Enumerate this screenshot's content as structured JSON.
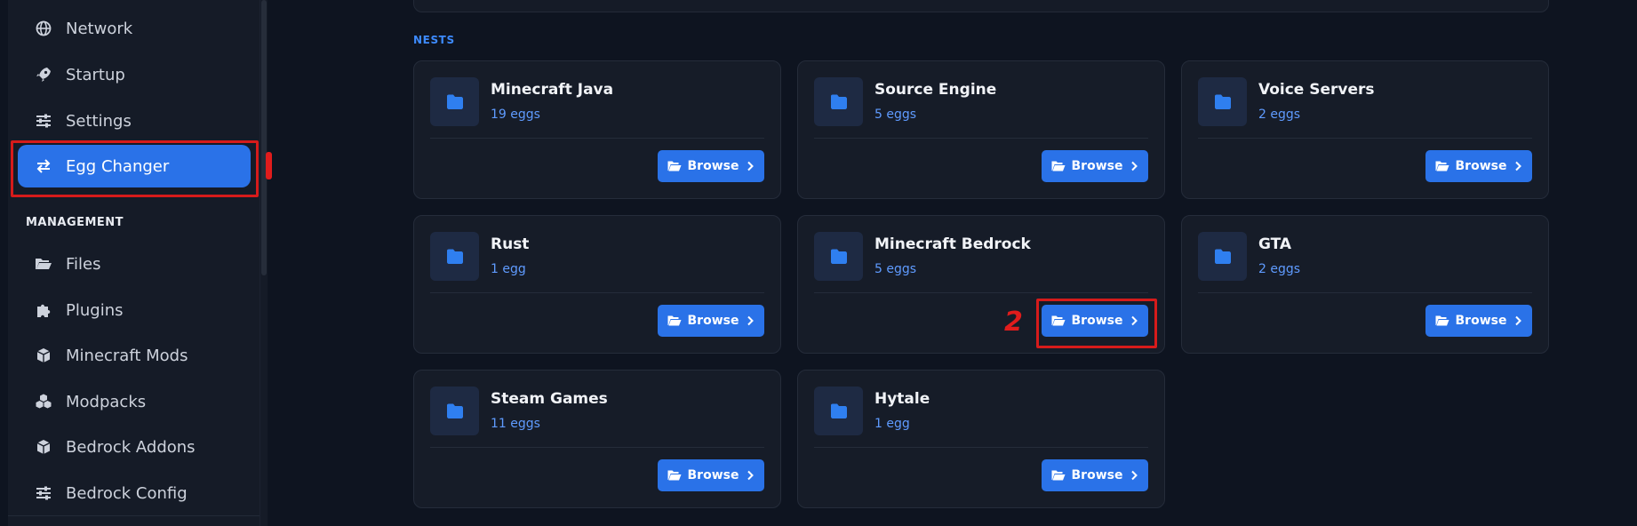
{
  "sidebar": {
    "items": [
      {
        "label": "Network",
        "icon": "globe-icon"
      },
      {
        "label": "Startup",
        "icon": "rocket-icon"
      },
      {
        "label": "Settings",
        "icon": "sliders-icon"
      },
      {
        "label": "Egg Changer",
        "icon": "swap-arrows-icon",
        "active": true
      }
    ],
    "section_label": "MANAGEMENT",
    "management_items": [
      {
        "label": "Files",
        "icon": "folder-open-icon"
      },
      {
        "label": "Plugins",
        "icon": "puzzle-icon"
      },
      {
        "label": "Minecraft Mods",
        "icon": "cube-icon"
      },
      {
        "label": "Modpacks",
        "icon": "cubes-icon"
      },
      {
        "label": "Bedrock Addons",
        "icon": "cube-icon"
      },
      {
        "label": "Bedrock Config",
        "icon": "sliders-icon"
      }
    ]
  },
  "main": {
    "section_label": "NESTS",
    "browse_label": "Browse",
    "nests": [
      {
        "name": "Minecraft Java",
        "count": "19 eggs"
      },
      {
        "name": "Source Engine",
        "count": "5 eggs"
      },
      {
        "name": "Voice Servers",
        "count": "2 eggs"
      },
      {
        "name": "Rust",
        "count": "1 egg"
      },
      {
        "name": "Minecraft Bedrock",
        "count": "5 eggs"
      },
      {
        "name": "GTA",
        "count": "2 eggs"
      },
      {
        "name": "Steam Games",
        "count": "11 eggs"
      },
      {
        "name": "Hytale",
        "count": "1 egg"
      }
    ]
  },
  "annotation": {
    "number": "2"
  },
  "colors": {
    "accent": "#2a72e8",
    "highlight": "#d61b1b",
    "count_text": "#5f9bff"
  }
}
